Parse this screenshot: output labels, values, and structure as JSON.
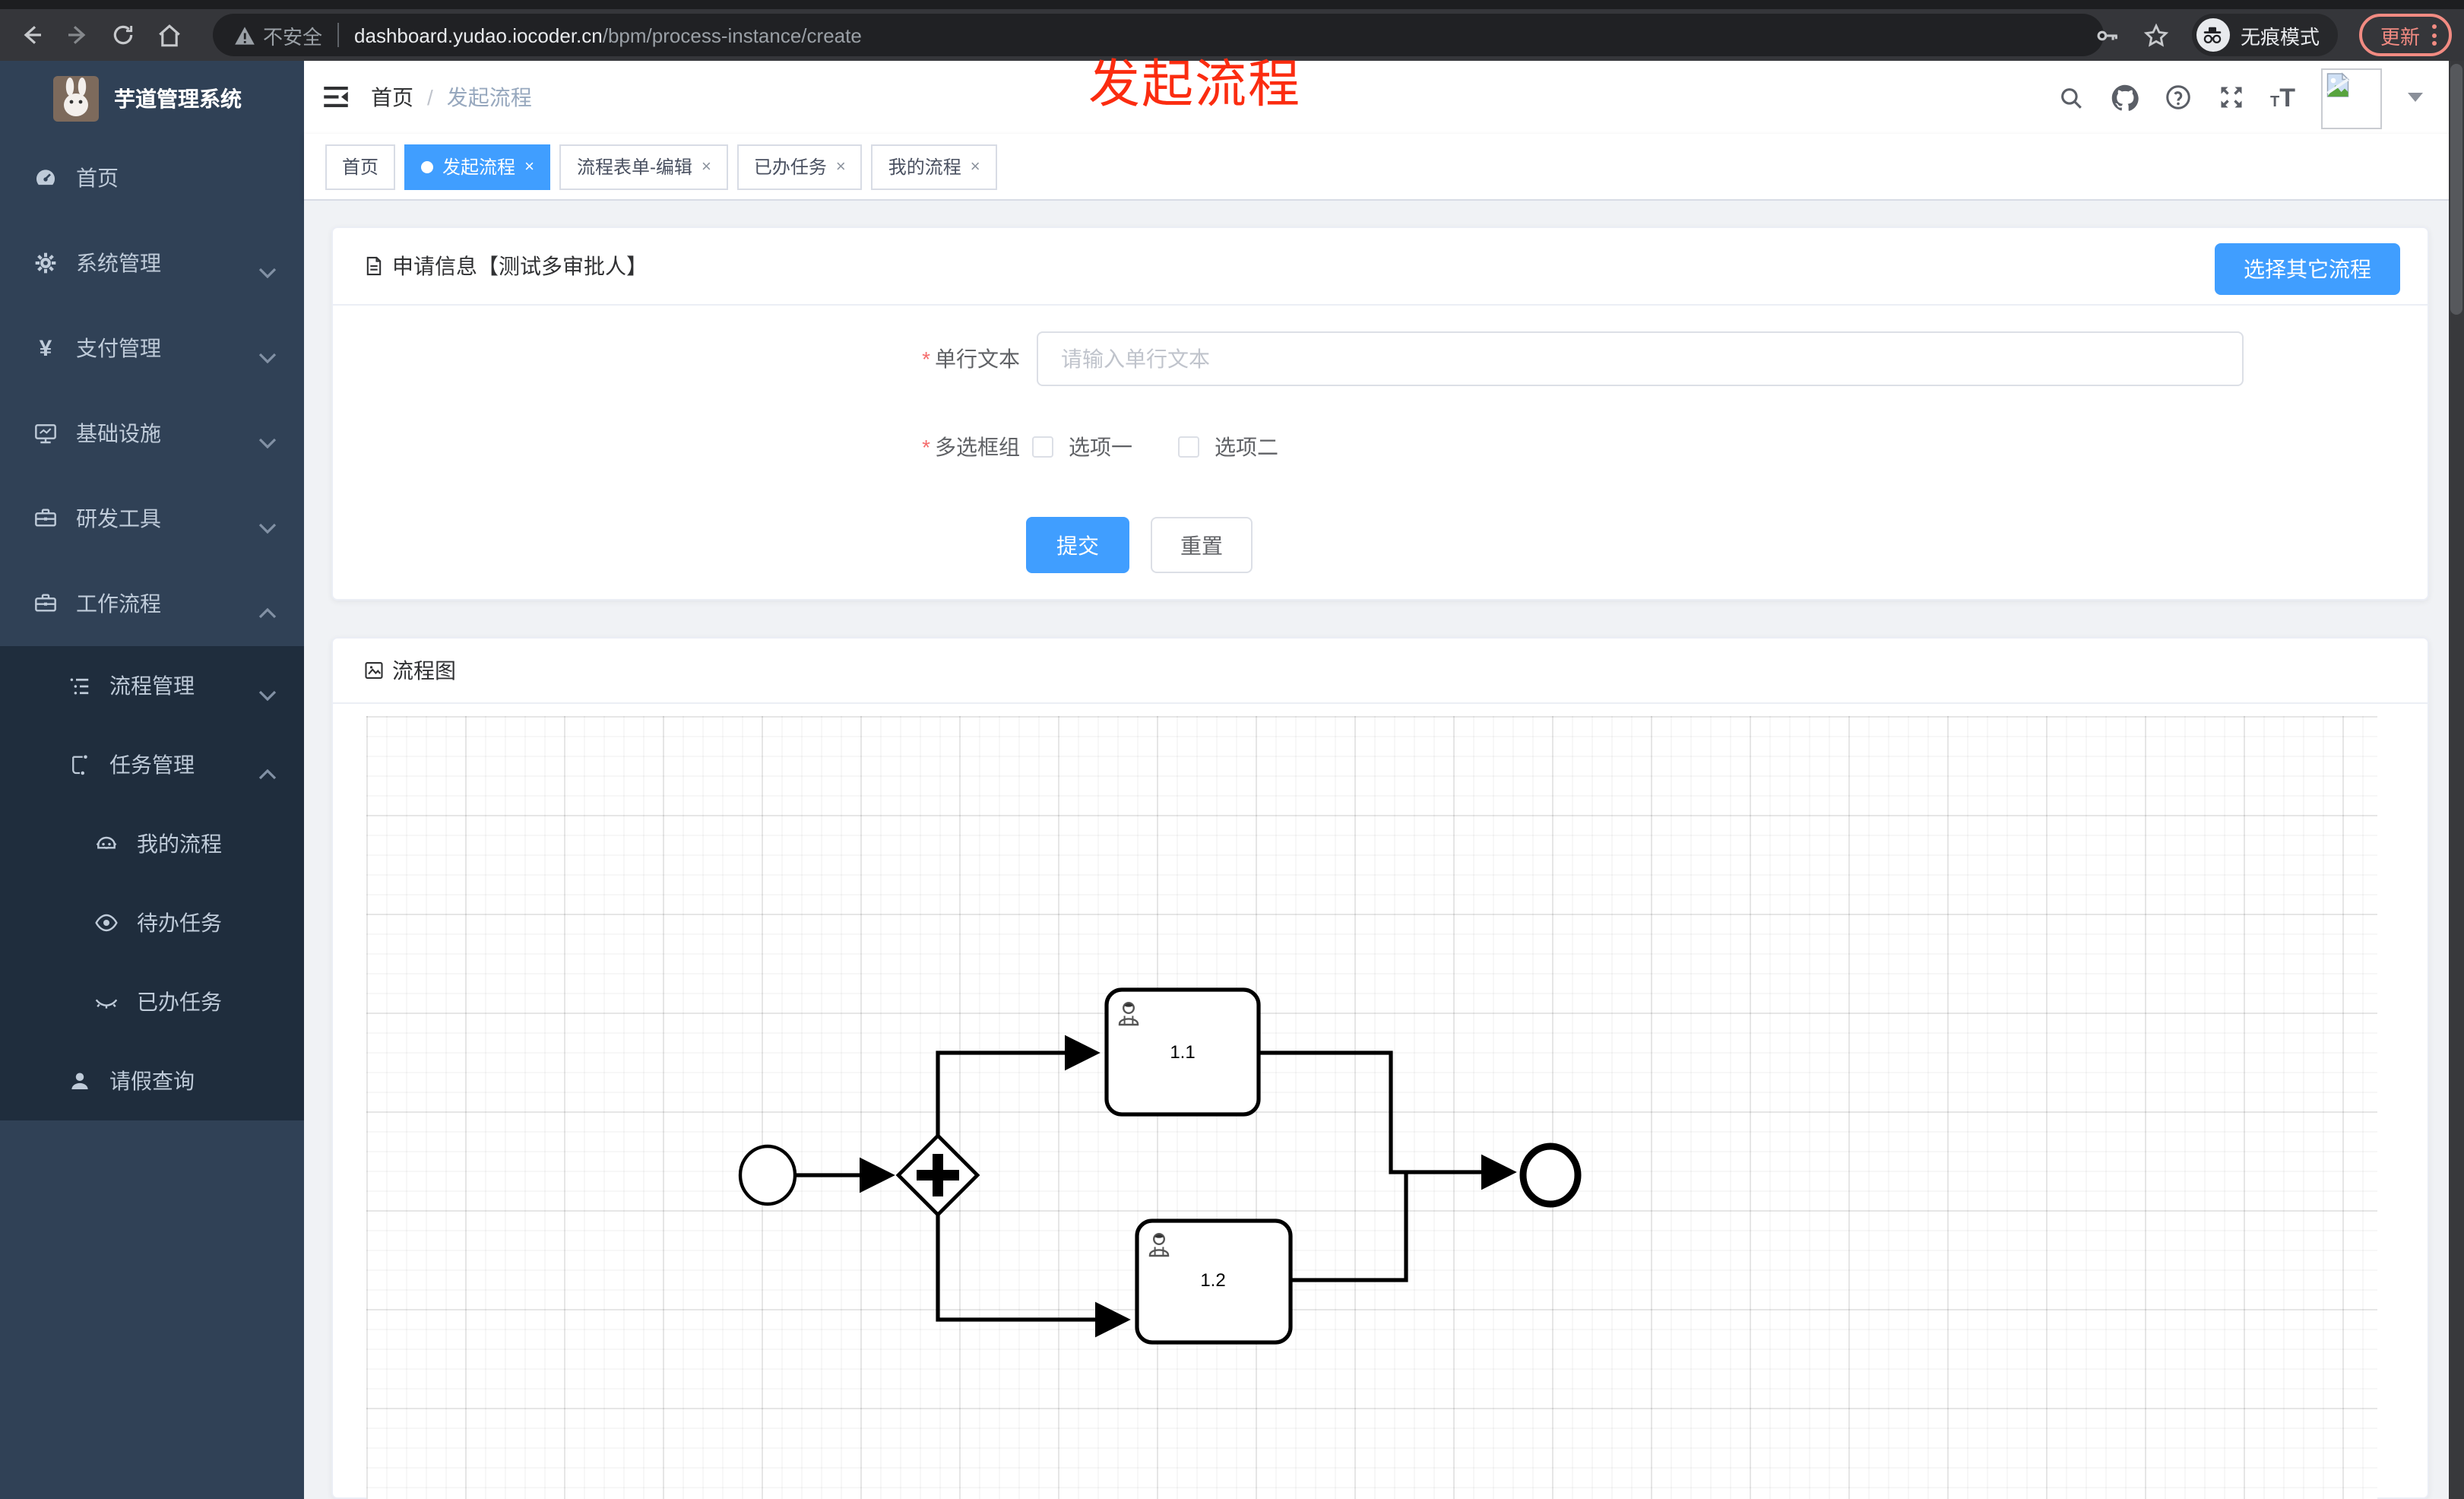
{
  "browser": {
    "security_label": "不安全",
    "url_host": "dashboard.yudao.iocoder.cn",
    "url_path": "/bpm/process-instance/create",
    "incognito_label": "无痕模式",
    "update_label": "更新"
  },
  "annotation": {
    "text": "发起流程",
    "color": "#fb2c10"
  },
  "sidebar": {
    "title": "芋道管理系统",
    "items": [
      {
        "label": "首页",
        "expandable": false
      },
      {
        "label": "系统管理",
        "expandable": true,
        "state": "collapsed"
      },
      {
        "label": "支付管理",
        "expandable": true,
        "state": "collapsed"
      },
      {
        "label": "基础设施",
        "expandable": true,
        "state": "collapsed"
      },
      {
        "label": "研发工具",
        "expandable": true,
        "state": "collapsed"
      },
      {
        "label": "工作流程",
        "expandable": true,
        "state": "expanded"
      }
    ],
    "workflow_children": [
      {
        "label": "流程管理",
        "state": "collapsed"
      },
      {
        "label": "任务管理",
        "state": "expanded"
      }
    ],
    "task_children": [
      {
        "label": "我的流程"
      },
      {
        "label": "待办任务"
      },
      {
        "label": "已办任务"
      }
    ],
    "leave_query_label": "请假查询"
  },
  "header": {
    "breadcrumb": {
      "home": "首页",
      "separator": "/",
      "current": "发起流程"
    }
  },
  "ui": {
    "close_glyph": "×",
    "required_mark": "*"
  },
  "tabs": [
    {
      "label": "首页",
      "active": false,
      "closable": false
    },
    {
      "label": "发起流程",
      "active": true,
      "closable": true
    },
    {
      "label": "流程表单-编辑",
      "active": false,
      "closable": true
    },
    {
      "label": "已办任务",
      "active": false,
      "closable": true
    },
    {
      "label": "我的流程",
      "active": false,
      "closable": true
    }
  ],
  "apply_card": {
    "title": "申请信息【测试多审批人】",
    "choose_other_button": "选择其它流程",
    "fields": [
      {
        "label": "单行文本",
        "required": true,
        "placeholder": "请输入单行文本",
        "value": ""
      },
      {
        "label": "多选框组",
        "required": true,
        "options": [
          {
            "label": "选项一",
            "checked": false
          },
          {
            "label": "选项二",
            "checked": false
          }
        ]
      }
    ],
    "submit_label": "提交",
    "reset_label": "重置"
  },
  "diagram_card": {
    "title": "流程图",
    "chart_data": {
      "type": "bpmn-flow",
      "nodes": [
        {
          "id": "start",
          "kind": "start-event",
          "label": ""
        },
        {
          "id": "gateway",
          "kind": "parallel-gateway",
          "label": ""
        },
        {
          "id": "task1",
          "kind": "user-task",
          "label": "1.1"
        },
        {
          "id": "task2",
          "kind": "user-task",
          "label": "1.2"
        },
        {
          "id": "end",
          "kind": "end-event",
          "label": ""
        }
      ],
      "edges": [
        {
          "from": "start",
          "to": "gateway"
        },
        {
          "from": "gateway",
          "to": "task1"
        },
        {
          "from": "gateway",
          "to": "task2"
        },
        {
          "from": "task1",
          "to": "end"
        },
        {
          "from": "task2",
          "to": "end"
        }
      ]
    }
  },
  "colors": {
    "accent": "#409eff",
    "sidebar_bg": "#304156",
    "submenu_bg": "#1f2d3d",
    "sidebar_text": "#bfcbd9",
    "annotation_red": "#fb2c10",
    "chrome_bg": "#35363a",
    "update_badge": "#f28b82",
    "page_bg": "#f0f2f5"
  }
}
